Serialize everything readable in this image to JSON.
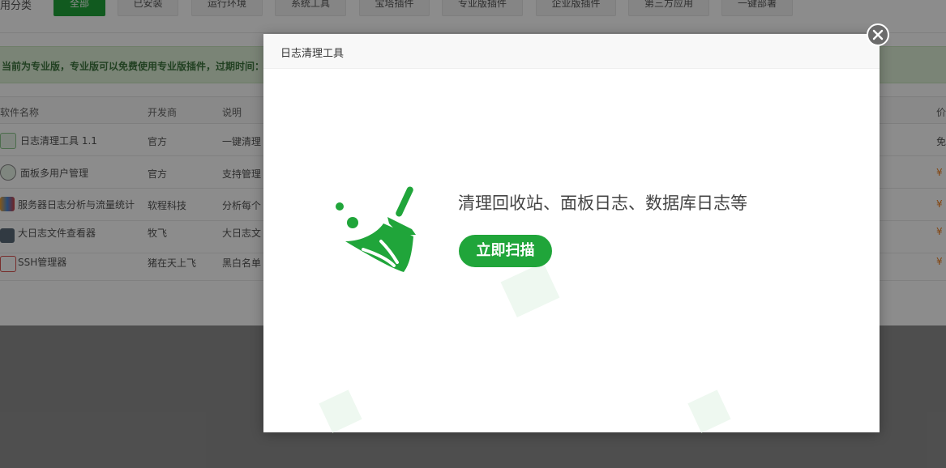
{
  "filter": {
    "label": "用分类",
    "buttons": [
      "全部",
      "已安装",
      "运行环境",
      "系统工具",
      "宝塔插件",
      "专业版插件",
      "企业版插件",
      "第三方应用",
      "一键部署"
    ]
  },
  "notice": {
    "text": "当前为专业版，专业版可以免费使用专业版插件，过期时间："
  },
  "table": {
    "headers": {
      "name": "软件名称",
      "dev": "开发商",
      "desc": "说明",
      "price": "价"
    },
    "rows": [
      {
        "name": "日志清理工具 1.1",
        "dev": "官方",
        "desc": "一键清理",
        "price": "免"
      },
      {
        "name": "面板多用户管理",
        "dev": "官方",
        "desc": "支持管理",
        "price": "¥"
      },
      {
        "name": "服务器日志分析与流量统计",
        "dev": "软程科技",
        "desc": "分析每个",
        "price": "¥"
      },
      {
        "name": "大日志文件查看器",
        "dev": "牧飞",
        "desc": "大日志文",
        "price": "¥"
      },
      {
        "name": "SSH管理器",
        "dev": "猪在天上飞",
        "desc": "黑白名单",
        "price": "¥"
      }
    ]
  },
  "modal": {
    "title": "日志清理工具",
    "headline": "清理回收站、面板日志、数据库日志等",
    "scan_button": "立即扫描"
  },
  "colors": {
    "accent": "#20a53a",
    "price": "#f07d1b"
  },
  "icons": {
    "close": "close-icon",
    "broom": "broom-icon"
  }
}
